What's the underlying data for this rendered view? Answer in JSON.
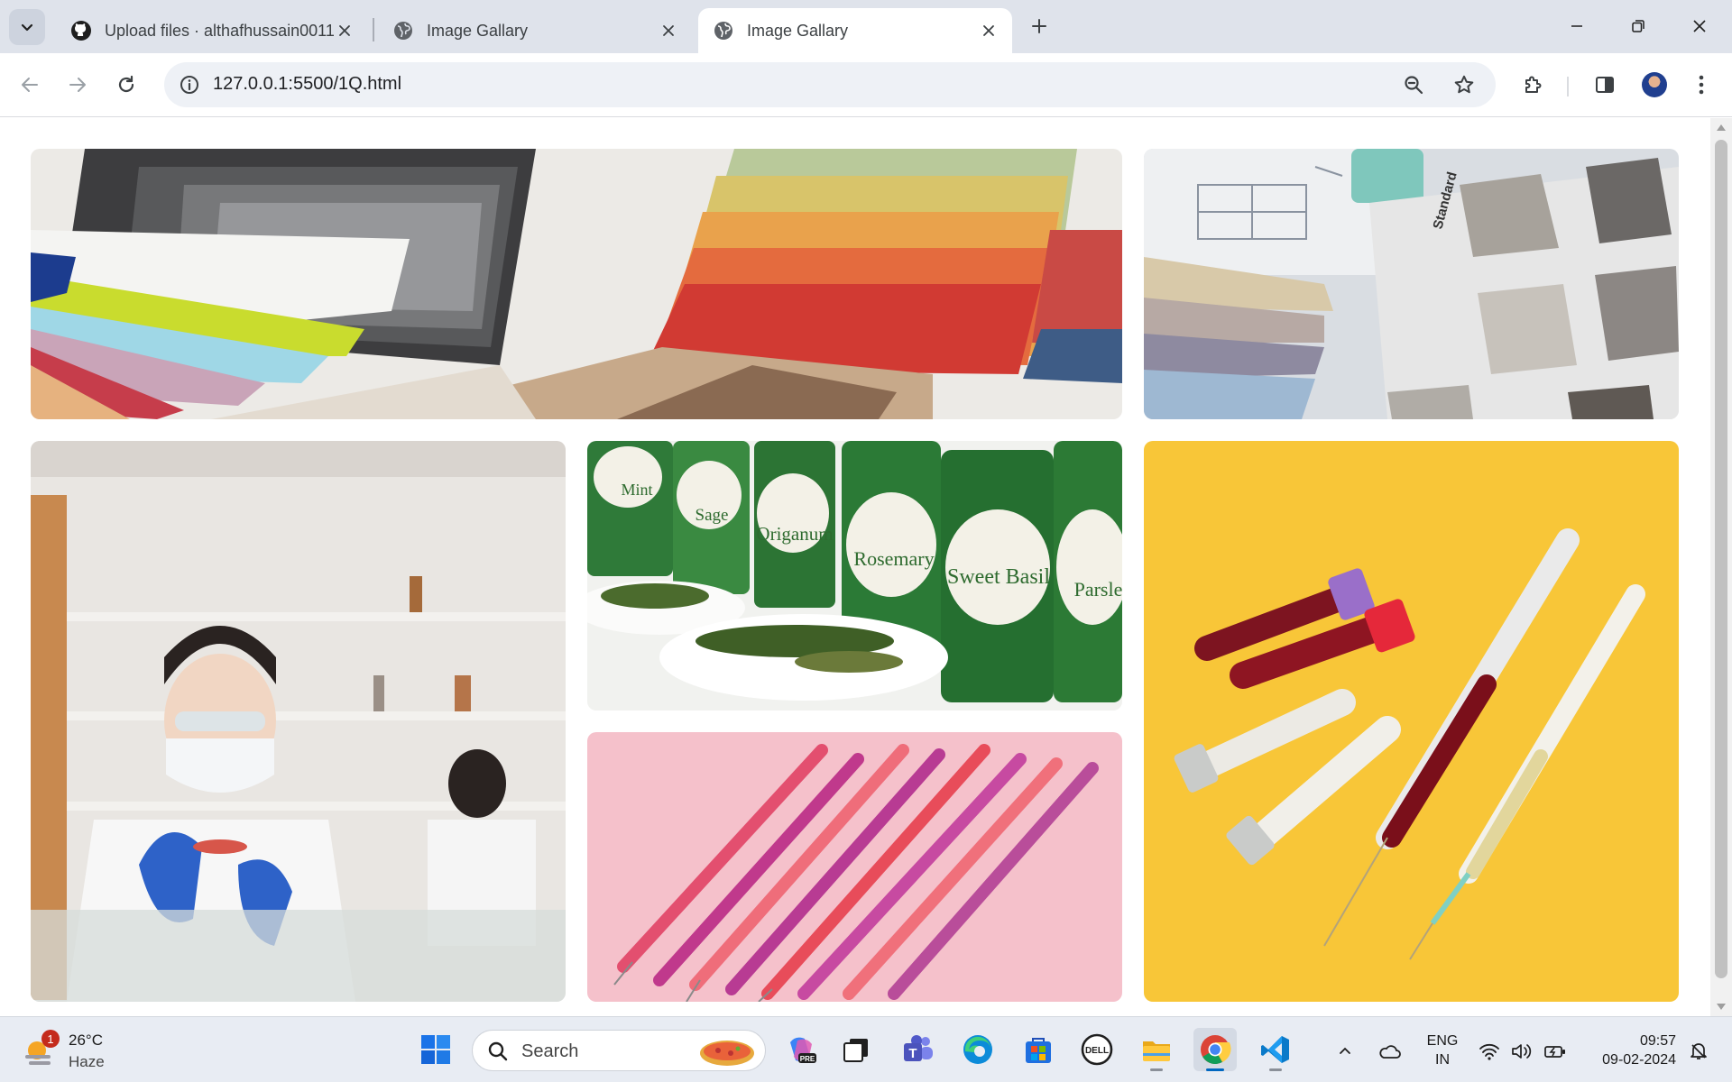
{
  "browser": {
    "tabs": [
      {
        "title": "Upload files · althafhussain0011",
        "favicon": "github-icon",
        "active": false
      },
      {
        "title": "Image Gallary",
        "favicon": "globe-icon",
        "active": false
      },
      {
        "title": "Image Gallary",
        "favicon": "globe-icon",
        "active": true
      }
    ],
    "address_bar": {
      "url": "127.0.0.1:5500/1Q.html"
    }
  },
  "gallery": {
    "images": [
      {
        "subject": "fabric swatches and color fan deck",
        "labels": []
      },
      {
        "subject": "color swatches and material samples on blueprint",
        "labels": [
          "Standard"
        ]
      },
      {
        "subject": "scientist in lab with petri dish",
        "labels": []
      },
      {
        "subject": "spice jars with herbs",
        "labels": [
          "Mint",
          "Sage",
          "Origanum",
          "Rosemary",
          "Sweet Basil",
          "Parsley"
        ]
      },
      {
        "subject": "syringes on pink background",
        "labels": []
      },
      {
        "subject": "blood sample tubes and syringes on yellow",
        "labels": []
      }
    ]
  },
  "taskbar": {
    "weather": {
      "temp": "26°C",
      "condition": "Haze",
      "badge": "1"
    },
    "search_label": "Search",
    "language": {
      "line1": "ENG",
      "line2": "IN"
    },
    "clock": {
      "time": "09:57",
      "date": "09-02-2024"
    },
    "accent_color": "#0067c0"
  }
}
